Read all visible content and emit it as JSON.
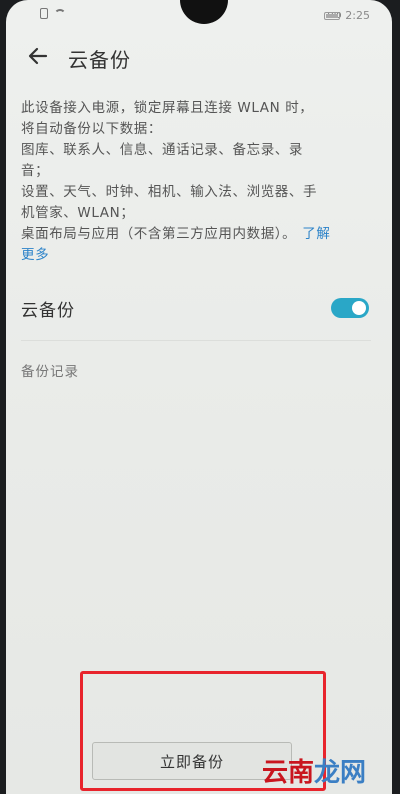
{
  "status_bar": {
    "battery_text": "100",
    "time": "2:25"
  },
  "header": {
    "back_icon": "arrow-left-icon",
    "title": "云备份"
  },
  "description": {
    "lines": [
      "此设备接入电源，锁定屏幕且连接 WLAN 时，",
      "将自动备份以下数据：",
      "图库、联系人、信息、通话记录、备忘录、录",
      "音；",
      "设置、天气、时钟、相机、输入法、浏览器、手",
      "机管家、WLAN；"
    ],
    "last_line": "桌面布局与应用（不含第三方应用内数据）。",
    "learn_more_part1": "了解",
    "learn_more_part2": "更多"
  },
  "cloud_backup": {
    "label": "云备份",
    "enabled": true,
    "accent_color": "#2aa7c7"
  },
  "records": {
    "section_title": "备份记录"
  },
  "actions": {
    "backup_now_label": "立即备份",
    "highlight_color": "#e8242c"
  },
  "watermark": {
    "part1": "云南",
    "part2": "龙网"
  }
}
